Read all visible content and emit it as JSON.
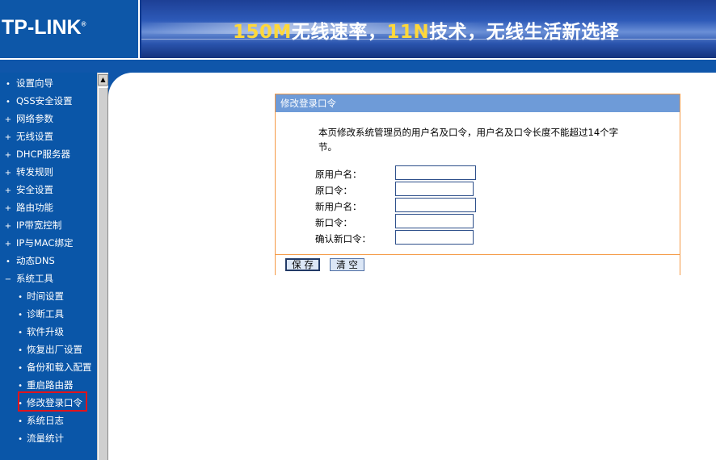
{
  "header": {
    "logo": "TP-LINK",
    "logo_mark": "®",
    "banner_part1": "150M",
    "banner_part2": "无线速率，",
    "banner_part3": "11N",
    "banner_part4": "技术，无线生活新选择"
  },
  "sidebar": {
    "items": [
      {
        "bullet": "•",
        "label": "设置向导"
      },
      {
        "bullet": "•",
        "label": "QSS安全设置"
      },
      {
        "bullet": "+",
        "label": "网络参数"
      },
      {
        "bullet": "+",
        "label": "无线设置"
      },
      {
        "bullet": "+",
        "label": "DHCP服务器"
      },
      {
        "bullet": "+",
        "label": "转发规则"
      },
      {
        "bullet": "+",
        "label": "安全设置"
      },
      {
        "bullet": "+",
        "label": "路由功能"
      },
      {
        "bullet": "+",
        "label": "IP带宽控制"
      },
      {
        "bullet": "+",
        "label": "IP与MAC绑定"
      },
      {
        "bullet": "•",
        "label": "动态DNS"
      },
      {
        "bullet": "−",
        "label": "系统工具"
      },
      {
        "bullet": "•",
        "label": "时间设置"
      },
      {
        "bullet": "•",
        "label": "诊断工具"
      },
      {
        "bullet": "•",
        "label": "软件升级"
      },
      {
        "bullet": "•",
        "label": "恢复出厂设置"
      },
      {
        "bullet": "•",
        "label": "备份和载入配置"
      },
      {
        "bullet": "•",
        "label": "重启路由器"
      },
      {
        "bullet": "•",
        "label": "修改登录口令"
      },
      {
        "bullet": "•",
        "label": "系统日志"
      },
      {
        "bullet": "•",
        "label": "流量统计"
      }
    ]
  },
  "scrollbar": {
    "up_arrow": "▲"
  },
  "panel": {
    "title": "修改登录口令",
    "intro": "本页修改系统管理员的用户名及口令，用户名及口令长度不能超过14个字节。",
    "fields": [
      {
        "label": "原用户名：",
        "value": ""
      },
      {
        "label": "原口令：",
        "value": ""
      },
      {
        "label": "新用户名：",
        "value": ""
      },
      {
        "label": "新口令：",
        "value": ""
      },
      {
        "label": "确认新口令：",
        "value": ""
      }
    ],
    "save_label": "保 存",
    "clear_label": "清 空"
  },
  "colors": {
    "sidebar_bg": "#0a56a8",
    "panel_title_bg": "#6e9bd8",
    "panel_border": "#f59a46",
    "highlight_box": "#e0141c"
  }
}
